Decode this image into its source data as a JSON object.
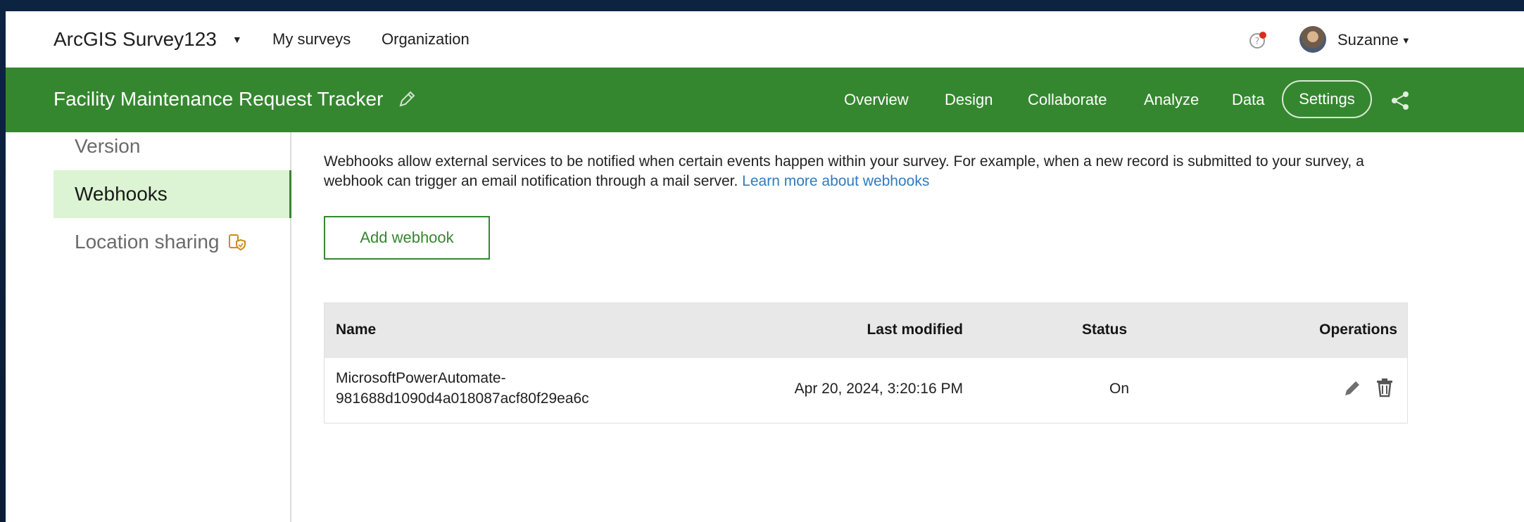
{
  "header": {
    "app_title": "ArcGIS Survey123",
    "nav": [
      "My surveys",
      "Organization"
    ],
    "user_name": "Suzanne"
  },
  "survey": {
    "title": "Facility Maintenance Request Tracker",
    "tabs": [
      "Overview",
      "Design",
      "Collaborate",
      "Analyze",
      "Data"
    ],
    "active_tab": "Settings"
  },
  "sidebar": {
    "items": [
      {
        "label": "Version",
        "active": false
      },
      {
        "label": "Webhooks",
        "active": true
      },
      {
        "label": "Location sharing",
        "active": false
      }
    ]
  },
  "main": {
    "description": "Webhooks allow external services to be notified when certain events happen within your survey. For example, when a new record is submitted to your survey, a webhook can trigger an email notification through a mail server.",
    "learn_more": "Learn more about webhooks",
    "add_button": "Add webhook",
    "table": {
      "headers": [
        "Name",
        "Last modified",
        "Status",
        "Operations"
      ],
      "rows": [
        {
          "name_line1": "MicrosoftPowerAutomate-",
          "name_line2": "981688d1090d4a018087acf80f29ea6c",
          "last_modified": "Apr 20, 2024, 3:20:16 PM",
          "status": "On"
        }
      ]
    }
  },
  "colors": {
    "brand_green": "#35872f",
    "active_side_bg": "#dcf4d3",
    "link_blue": "#2f7bbf"
  }
}
